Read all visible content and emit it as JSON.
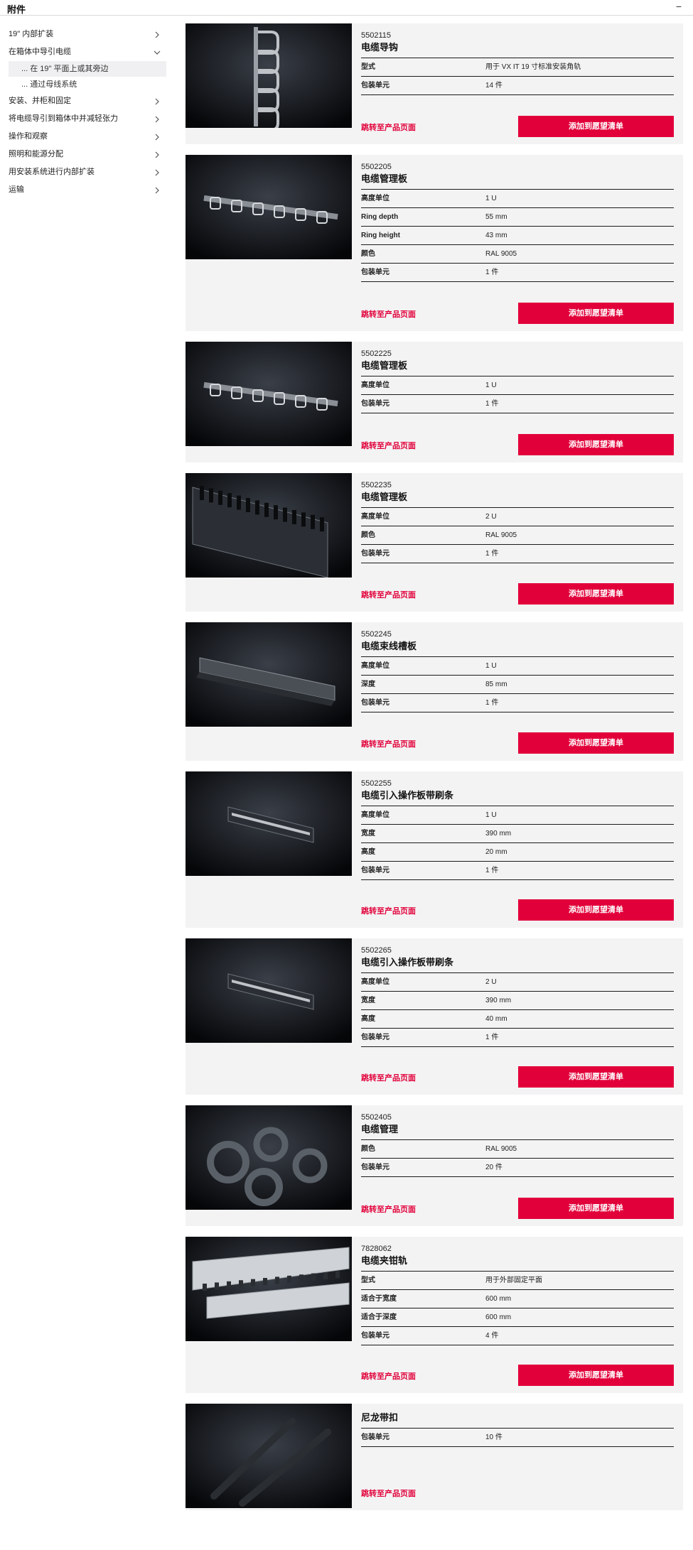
{
  "header": {
    "title": "附件",
    "collapse_icon": "minus-icon"
  },
  "sidebar": {
    "items": [
      {
        "label": "19\" 内部扩装",
        "expanded": false
      },
      {
        "label": "在箱体中导引电缆",
        "expanded": true,
        "subitems": [
          {
            "label": "... 在 19\" 平面上或其旁边",
            "active": true
          },
          {
            "label": "... 通过母线系统",
            "active": false
          }
        ]
      },
      {
        "label": "安装、并柜和固定",
        "expanded": false
      },
      {
        "label": "将电缆导引到箱体中并减轻张力",
        "expanded": false
      },
      {
        "label": "操作和观察",
        "expanded": false
      },
      {
        "label": "照明和能源分配",
        "expanded": false
      },
      {
        "label": "用安装系统进行内部扩装",
        "expanded": false
      },
      {
        "label": "运输",
        "expanded": false
      }
    ]
  },
  "common": {
    "link_label": "跳转至产品页面",
    "button_label": "添加到愿望清单",
    "accent_color": "#e2003a"
  },
  "products": [
    {
      "id": "5502115",
      "name": "电缆导钩",
      "image": "cable-hook-image",
      "specs": [
        {
          "k": "型式",
          "v": "用于 VX IT 19 寸标准安装角轨"
        },
        {
          "k": "包装单元",
          "v": "14 件"
        }
      ]
    },
    {
      "id": "5502205",
      "name": "电缆管理板",
      "image": "cable-management-panel-image",
      "specs": [
        {
          "k": "高度单位",
          "v": "1 U"
        },
        {
          "k": "Ring depth",
          "v": "55 mm"
        },
        {
          "k": "Ring height",
          "v": "43 mm"
        },
        {
          "k": "颜色",
          "v": "RAL 9005"
        },
        {
          "k": "包装单元",
          "v": "1 件"
        }
      ]
    },
    {
      "id": "5502225",
      "name": "电缆管理板",
      "image": "cable-management-panel-image",
      "specs": [
        {
          "k": "高度单位",
          "v": "1 U"
        },
        {
          "k": "包装单元",
          "v": "1 件"
        }
      ]
    },
    {
      "id": "5502235",
      "name": "电缆管理板",
      "image": "cable-duct-image",
      "specs": [
        {
          "k": "高度单位",
          "v": "2 U"
        },
        {
          "k": "颜色",
          "v": "RAL 9005"
        },
        {
          "k": "包装单元",
          "v": "1 件"
        }
      ]
    },
    {
      "id": "5502245",
      "name": "电缆束线槽板",
      "image": "cable-tray-panel-image",
      "specs": [
        {
          "k": "高度单位",
          "v": "1 U"
        },
        {
          "k": "深度",
          "v": "85 mm"
        },
        {
          "k": "包装单元",
          "v": "1 件"
        }
      ]
    },
    {
      "id": "5502255",
      "name": "电缆引入操作板带刷条",
      "image": "brush-strip-panel-image",
      "specs": [
        {
          "k": "高度单位",
          "v": "1 U"
        },
        {
          "k": "宽度",
          "v": "390 mm"
        },
        {
          "k": "高度",
          "v": "20 mm"
        },
        {
          "k": "包装单元",
          "v": "1 件"
        }
      ]
    },
    {
      "id": "5502265",
      "name": "电缆引入操作板带刷条",
      "image": "brush-strip-panel-image",
      "specs": [
        {
          "k": "高度单位",
          "v": "2 U"
        },
        {
          "k": "宽度",
          "v": "390 mm"
        },
        {
          "k": "高度",
          "v": "40 mm"
        },
        {
          "k": "包装单元",
          "v": "1 件"
        }
      ]
    },
    {
      "id": "5502405",
      "name": "电缆管理",
      "image": "cable-management-clips-image",
      "specs": [
        {
          "k": "颜色",
          "v": "RAL 9005"
        },
        {
          "k": "包装单元",
          "v": "20 件"
        }
      ]
    },
    {
      "id": "7828062",
      "name": "电缆夹钳轨",
      "image": "cable-clamp-rail-image",
      "specs": [
        {
          "k": "型式",
          "v": "用于外部固定平面"
        },
        {
          "k": "适合于宽度",
          "v": "600 mm"
        },
        {
          "k": "适合于深度",
          "v": "600 mm"
        },
        {
          "k": "包装单元",
          "v": "4 件"
        }
      ]
    },
    {
      "id": "",
      "name": "尼龙带扣",
      "image": "nylon-strap-image",
      "specs": [
        {
          "k": "包装单元",
          "v": "10 件"
        }
      ],
      "no_button": true
    }
  ]
}
